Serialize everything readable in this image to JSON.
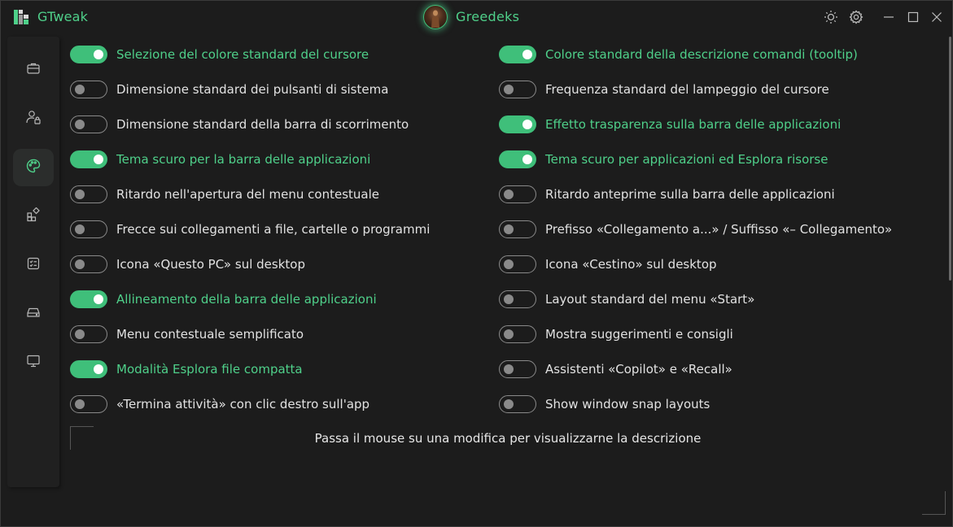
{
  "app": {
    "title": "GTweak"
  },
  "user": {
    "name": "Greedeks"
  },
  "window_controls": [
    "sun-icon",
    "gear-icon",
    "minimize-icon",
    "maximize-icon",
    "close-icon"
  ],
  "sidebar": {
    "items": [
      {
        "name": "briefcase-icon",
        "active": false
      },
      {
        "name": "user-lock-icon",
        "active": false
      },
      {
        "name": "palette-icon",
        "active": true
      },
      {
        "name": "apps-icon",
        "active": false
      },
      {
        "name": "checklist-icon",
        "active": false
      },
      {
        "name": "drive-icon",
        "active": false
      },
      {
        "name": "monitor-icon",
        "active": false
      }
    ]
  },
  "toggles": {
    "left": [
      {
        "label": "Selezione del colore standard del cursore",
        "on": true
      },
      {
        "label": "Dimensione standard dei pulsanti di sistema",
        "on": false
      },
      {
        "label": "Dimensione standard della barra di scorrimento",
        "on": false
      },
      {
        "label": "Tema scuro per la barra delle applicazioni",
        "on": true
      },
      {
        "label": "Ritardo nell'apertura del menu contestuale",
        "on": false
      },
      {
        "label": "Frecce sui collegamenti a file, cartelle o programmi",
        "on": false
      },
      {
        "label": "Icona «Questo PC» sul desktop",
        "on": false
      },
      {
        "label": "Allineamento della barra delle applicazioni",
        "on": true
      },
      {
        "label": "Menu contestuale semplificato",
        "on": false
      },
      {
        "label": "Modalità Esplora file compatta",
        "on": true
      },
      {
        "label": "«Termina attività» con clic destro sull'app",
        "on": false
      }
    ],
    "right": [
      {
        "label": "Colore standard della descrizione comandi (tooltip)",
        "on": true
      },
      {
        "label": "Frequenza standard del lampeggio del cursore",
        "on": false
      },
      {
        "label": "Effetto trasparenza sulla barra delle applicazioni",
        "on": true
      },
      {
        "label": "Tema scuro per applicazioni ed Esplora risorse",
        "on": true
      },
      {
        "label": "Ritardo anteprime sulla barra delle applicazioni",
        "on": false
      },
      {
        "label": "Prefisso «Collegamento a...» / Suffisso «– Collegamento»",
        "on": false
      },
      {
        "label": "Icona «Cestino» sul desktop",
        "on": false
      },
      {
        "label": "Layout standard del menu «Start»",
        "on": false
      },
      {
        "label": "Mostra suggerimenti e consigli",
        "on": false
      },
      {
        "label": "Assistenti «Copilot» e «Recall»",
        "on": false
      },
      {
        "label": "Show window snap layouts",
        "on": false
      }
    ]
  },
  "description": {
    "text": "Passa il mouse su una modifica per visualizzarne la descrizione"
  },
  "colors": {
    "accent": "#4fd08a",
    "switch_on": "#3fbf7a",
    "background": "#1c1c1c"
  }
}
